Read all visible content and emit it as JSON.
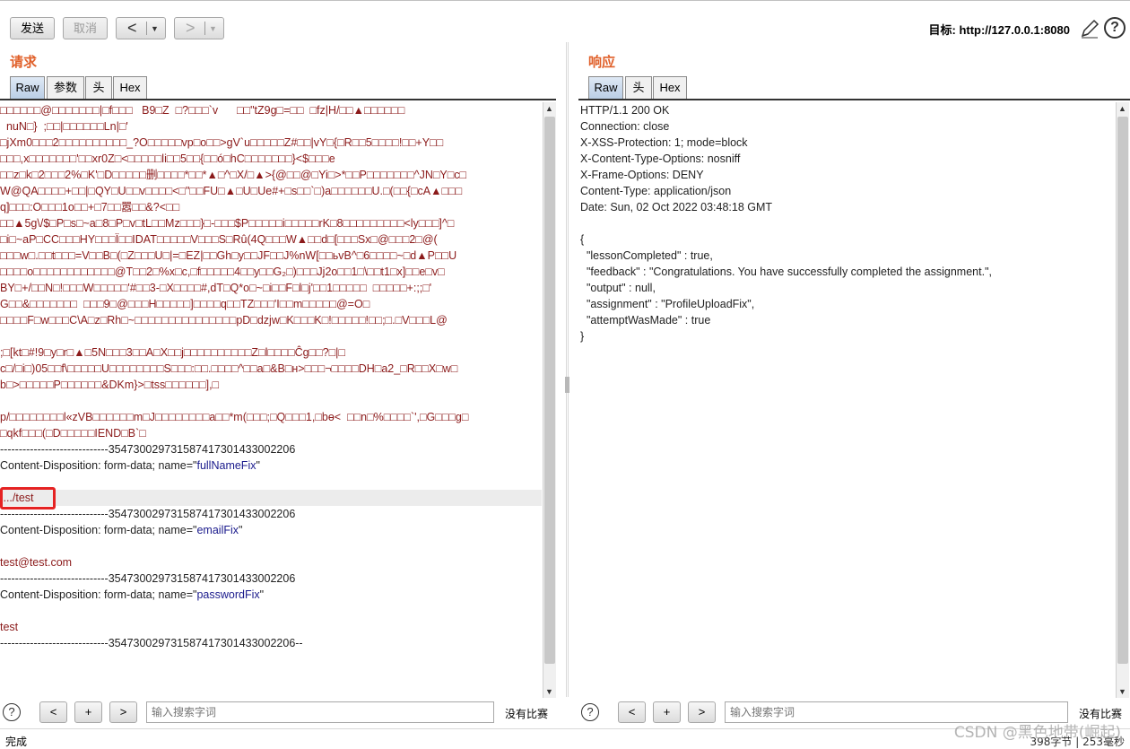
{
  "toolbar": {
    "send_label": "发送",
    "cancel_label": "取消",
    "back_arrow": "<",
    "forward_arrow": ">",
    "drop_arrow": "▼",
    "target_label": "目标: http://127.0.0.1:8080"
  },
  "request": {
    "title": "请求",
    "tabs": [
      "Raw",
      "参数",
      "头",
      "Hex"
    ],
    "lines": [
      {
        "t": "g",
        "text": "□□□□□□@□□□□□□□|□f□□□   B9□Z  □?□□□`v      □□\"tZ9g□=□□  □fz|H/□□▲□□□□□□"
      },
      {
        "t": "g",
        "text": "  nuN□}  ;□□|□□□□□□Ln|□'"
      },
      {
        "t": "g",
        "text": "□jXm0□□□2□□□□□□□□□□_?O□□□□□vp□o□□>gV`u□□□□□Z#□□|vY□{□R□□5□□□□!□□+Y□□"
      },
      {
        "t": "g",
        "text": "□□□,x□□□□□□□'□□xr0Z□<□□□□□li□□5□□{□□ó□hC□□□□□□□}<$□□□e"
      },
      {
        "t": "g",
        "text": "□□z□k□2□□□2%□K'□D□□□□□删□□□□*□□*▲□^□X/□▲>{@□□@□Yi□>*□□P□□□□□□□^JN□Y□c□"
      },
      {
        "t": "g",
        "text": "W@QA□□□□+□□|□QY□U□□v□□□□<□\"□□FU□▲□U□Ue#+□s□□`□)a□□□□□□U.□(□□{□cA▲□□□"
      },
      {
        "t": "g",
        "text": "q]□□□:O□□□1o□□+□7□□嚣□□&?<□□"
      },
      {
        "t": "g",
        "text": "□□▲5g\\/$□P□s□~a□8□P□v□tL□□Mz□□□}□-□□□$P□□□□□i□□□□□rK□8□□□□□□□□□<ly□□□]^□"
      },
      {
        "t": "g",
        "text": "□i□~aP□CC□□□HY□□□Ï□□IDAT□□□□□V□□□S□Rû(4Q□□□W▲□□d□[□□□Sx□@□□□2□@("
      },
      {
        "t": "g",
        "text": "□□□w□.□□t□□□=V□□B□(□Z□□□U□|=□EZ|□□Gh□y□□JF□□J%nW[□□ьvB^□6□□□□~□d▲P□□U"
      },
      {
        "t": "g",
        "text": "□□□□o□□□□□□□□□□□□@T□□2□%x□c,□f□□□□□4□□y□□G₂□)□□□Jj2o□□1□\\□□t1□x]□□e□v□"
      },
      {
        "t": "g",
        "text": "BY□+/□□N□!□□□W□□□□□'#□□3-□X□□□□#,dT□Q*o□~□i□□F□l□j'□□1□□□□□  □□□□□+:;;□'"
      },
      {
        "t": "g",
        "text": "G□□&□□□□□□□  □□□9□@□□□H□□□□□]□□□□q□□TZ□□□'I□□m□□□□□@=O□"
      },
      {
        "t": "g",
        "text": "□□□□F□w□□□C\\A□z□Rh□~□□□□□□□□□□□□□□□pD□dzjw□K□□□K□!□□□□□!□□;□.□V□□□L@"
      },
      {
        "t": "g",
        "text": ""
      },
      {
        "t": "g",
        "text": ";□[kt□#!9□y□r□▲□5N□□□3□□A□X□□j□□□□□□□□□□Z□l□□□□Ĉg□□?□|□"
      },
      {
        "t": "g",
        "text": "c□/□i□)05□□f\\□□□□□U□□□□□□□□S□□□:□□.□□□□^□□a□&B□н>□□□¬□□□□DH□a2_□R□□X□w□"
      },
      {
        "t": "g",
        "text": "b□>□□□□□P□□□□□□&DKm}>□tss□□□□□□],□"
      },
      {
        "t": "g",
        "text": ""
      },
      {
        "t": "g",
        "text": "p/□□□□□□□□l«zVB□□□□□□m□J□□□□□□□□a□□*m(□□□;□Q□□□1,□bɵ<  □□n□%□□□□`',□G□□□g□"
      },
      {
        "t": "g",
        "text": "□qkf□□□(□D□□□□□IEND□B`□"
      },
      {
        "t": "s",
        "text": "-----------------------------354730029731587417301433002206"
      },
      {
        "t": "m",
        "pre": "Content-Disposition: form-data; name=\"",
        "q": "fullNameFix",
        "post": "\""
      },
      {
        "t": "g",
        "text": ""
      },
      {
        "t": "v",
        "text": "..../test",
        "hl": true
      },
      {
        "t": "s",
        "text": "-----------------------------354730029731587417301433002206"
      },
      {
        "t": "m",
        "pre": "Content-Disposition: form-data; name=\"",
        "q": "emailFix",
        "post": "\""
      },
      {
        "t": "g",
        "text": ""
      },
      {
        "t": "v",
        "text": "test@test.com"
      },
      {
        "t": "s",
        "text": "-----------------------------354730029731587417301433002206"
      },
      {
        "t": "m",
        "pre": "Content-Disposition: form-data; name=\"",
        "q": "passwordFix",
        "post": "\""
      },
      {
        "t": "g",
        "text": ""
      },
      {
        "t": "v",
        "text": "test"
      },
      {
        "t": "s",
        "text": "-----------------------------354730029731587417301433002206--"
      }
    ]
  },
  "response": {
    "title": "响应",
    "tabs": [
      "Raw",
      "头",
      "Hex"
    ],
    "lines": [
      "HTTP/1.1 200 OK",
      "Connection: close",
      "X-XSS-Protection: 1; mode=block",
      "X-Content-Type-Options: nosniff",
      "X-Frame-Options: DENY",
      "Content-Type: application/json",
      "Date: Sun, 02 Oct 2022 03:48:18 GMT",
      "",
      "{",
      "  \"lessonCompleted\" : true,",
      "  \"feedback\" : \"Congratulations. You have successfully completed the assignment.\",",
      "  \"output\" : null,",
      "  \"assignment\" : \"ProfileUploadFix\",",
      "  \"attemptWasMade\" : true",
      "}"
    ]
  },
  "search": {
    "help": "?",
    "prev": "<",
    "add": "+",
    "next": ">",
    "placeholder": "输入搜索字词",
    "no_match": "没有比赛"
  },
  "status": {
    "left": "完成",
    "right": "398字节 | 253毫秒"
  },
  "watermark": "CSDN @黑色地带(崛起)",
  "colors": {
    "accent_title": "#e0602a",
    "highlight_box": "#e52222"
  }
}
